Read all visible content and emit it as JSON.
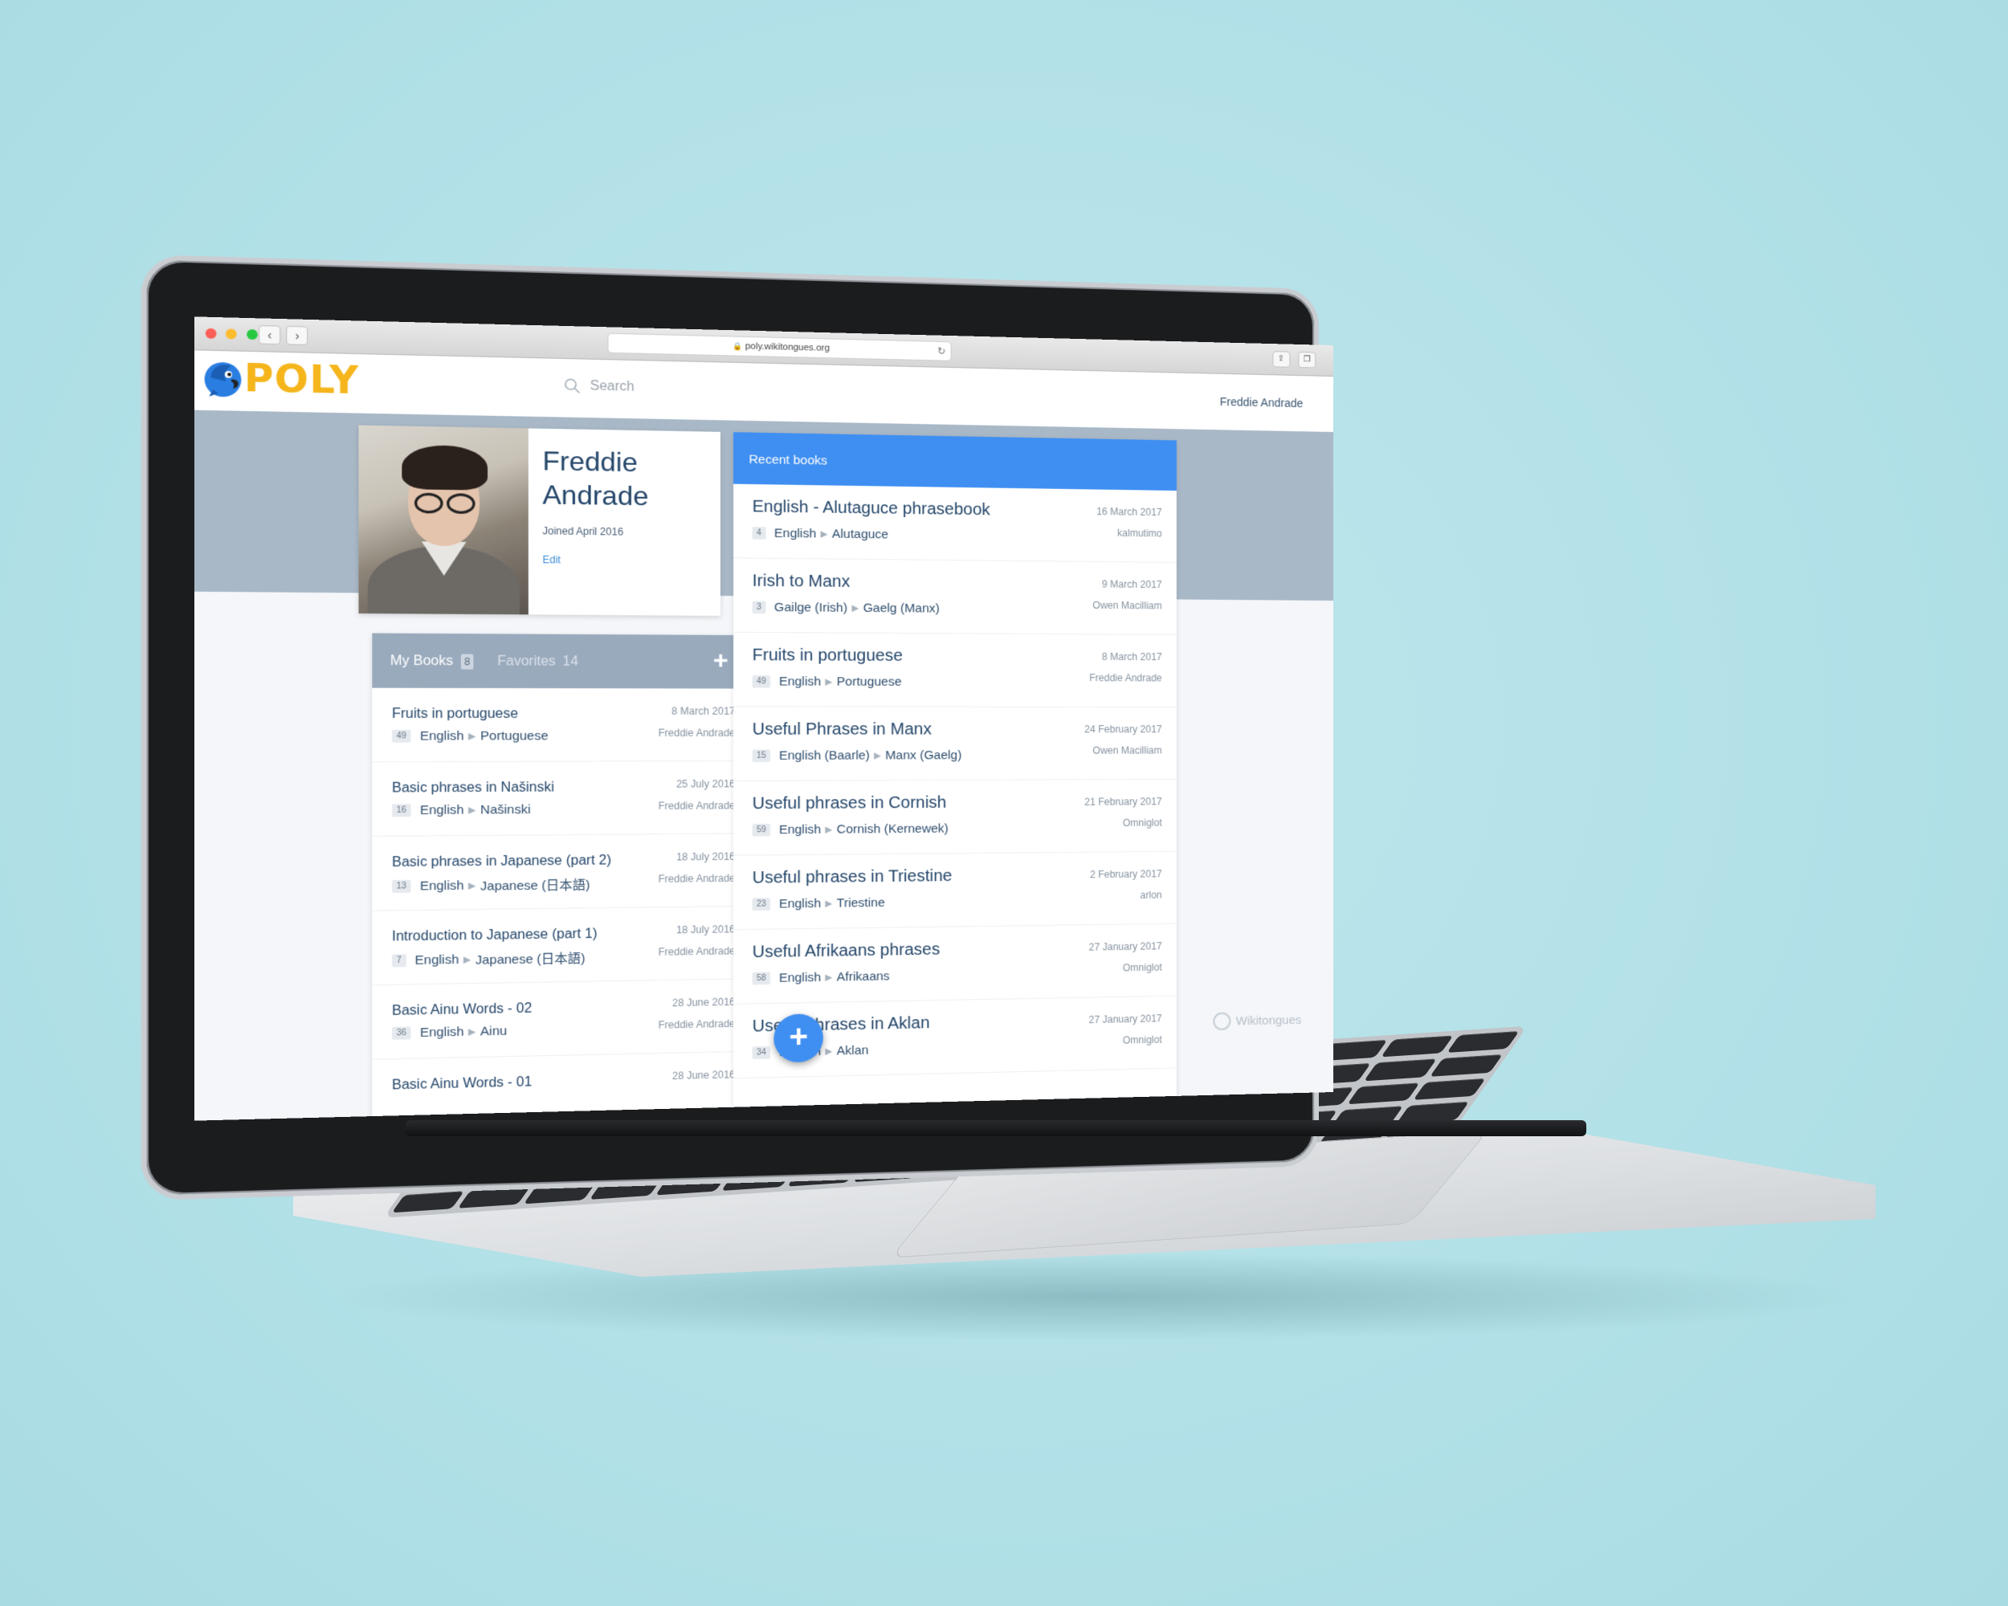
{
  "browser": {
    "url": "poly.wikitongues.org",
    "back_glyph": "‹",
    "forward_glyph": "›",
    "reload_glyph": "↻",
    "share_glyph": "⇪",
    "tabs_glyph": "❐"
  },
  "header": {
    "logo_text": "POLY",
    "search_placeholder": "Search",
    "username": "Freddie Andrade"
  },
  "profile": {
    "first_name": "Freddie",
    "last_name": "Andrade",
    "joined": "Joined April 2016",
    "edit_label": "Edit"
  },
  "my_books": {
    "tab_label": "My Books",
    "tab_count": "8",
    "favorites_label": "Favorites",
    "favorites_count": "14",
    "add_label": "+",
    "items": [
      {
        "title": "Fruits in portuguese",
        "count": "49",
        "from": "English",
        "to": "Portuguese",
        "date": "8 March 2017",
        "author": "Freddie Andrade"
      },
      {
        "title": "Basic phrases in Našinski",
        "count": "16",
        "from": "English",
        "to": "Našinski",
        "date": "25 July 2016",
        "author": "Freddie Andrade"
      },
      {
        "title": "Basic phrases in Japanese (part 2)",
        "count": "13",
        "from": "English",
        "to": "Japanese (日本語)",
        "date": "18 July 2016",
        "author": "Freddie Andrade"
      },
      {
        "title": "Introduction to Japanese (part 1)",
        "count": "7",
        "from": "English",
        "to": "Japanese (日本語)",
        "date": "18 July 2016",
        "author": "Freddie Andrade"
      },
      {
        "title": "Basic Ainu Words - 02",
        "count": "36",
        "from": "English",
        "to": "Ainu",
        "date": "28 June 2016",
        "author": "Freddie Andrade"
      },
      {
        "title": "Basic Ainu Words - 01",
        "count": "",
        "from": "",
        "to": "",
        "date": "28 June 2016",
        "author": ""
      }
    ]
  },
  "recent_books": {
    "header": "Recent books",
    "items": [
      {
        "title": "English - Alutaguce phrasebook",
        "count": "4",
        "from": "English",
        "to": "Alutaguce",
        "date": "16 March 2017",
        "author": "kalmutimo"
      },
      {
        "title": "Irish to Manx",
        "count": "3",
        "from": "Gailge (Irish)",
        "to": "Gaelg (Manx)",
        "date": "9 March 2017",
        "author": "Owen Macilliam"
      },
      {
        "title": "Fruits in portuguese",
        "count": "49",
        "from": "English",
        "to": "Portuguese",
        "date": "8 March 2017",
        "author": "Freddie Andrade"
      },
      {
        "title": "Useful Phrases in Manx",
        "count": "15",
        "from": "English (Baarle)",
        "to": "Manx (Gaelg)",
        "date": "24 February 2017",
        "author": "Owen Macilliam"
      },
      {
        "title": "Useful phrases in Cornish",
        "count": "59",
        "from": "English",
        "to": "Cornish (Kernewek)",
        "date": "21 February 2017",
        "author": "Omniglot"
      },
      {
        "title": "Useful phrases in Triestine",
        "count": "23",
        "from": "English",
        "to": "Triestine",
        "date": "2 February 2017",
        "author": "arlon"
      },
      {
        "title": "Useful Afrikaans phrases",
        "count": "58",
        "from": "English",
        "to": "Afrikaans",
        "date": "27 January 2017",
        "author": "Omniglot"
      },
      {
        "title": "Useful phrases in Aklan",
        "count": "34",
        "from": "English",
        "to": "Aklan",
        "date": "27 January 2017",
        "author": "Omniglot"
      }
    ]
  },
  "fab_label": "+",
  "footer_brand": "Wikitongues",
  "colors": {
    "accent_blue": "#3f8ff2",
    "logo_yellow": "#f5b51b",
    "panel_gray": "#9aaabd",
    "background": "#b3e1e8"
  }
}
